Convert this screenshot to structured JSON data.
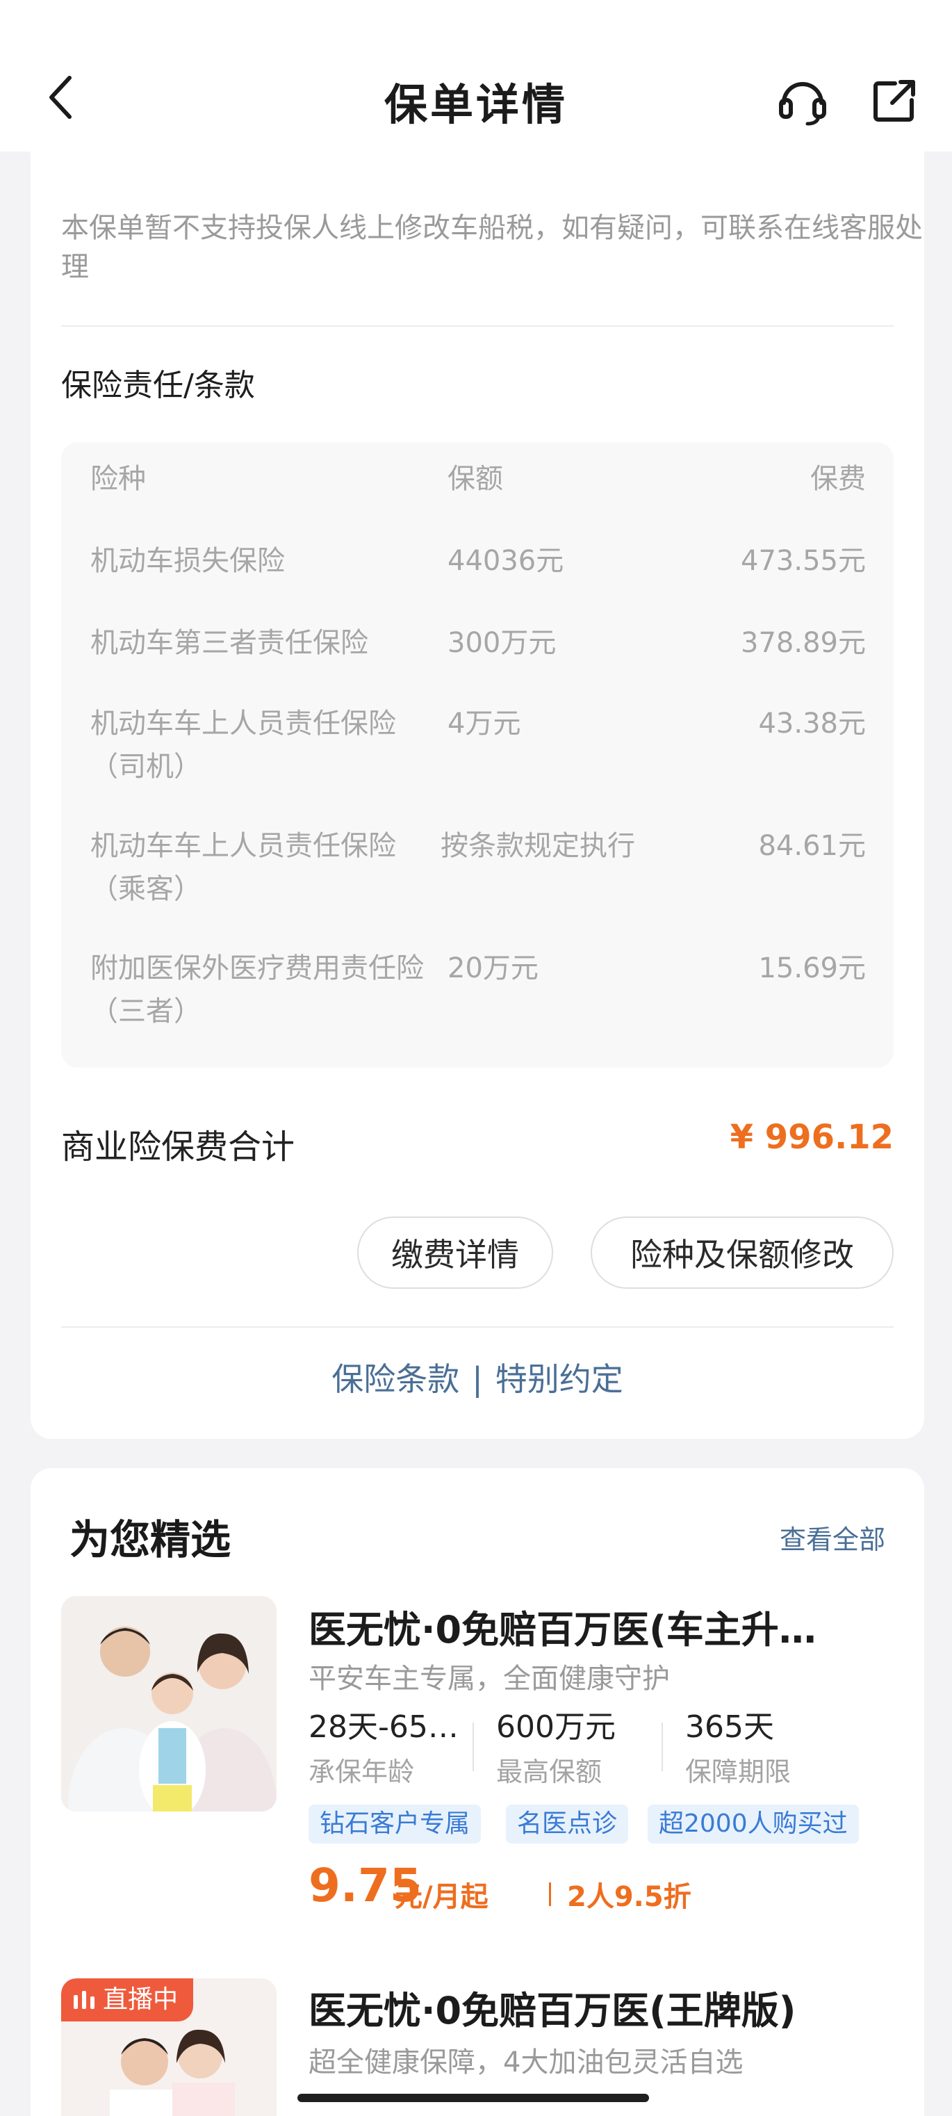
{
  "header": {
    "title": "保单详情"
  },
  "notice": "本保单暂不支持投保人线上修改车船税，如有疑问，可联系在线客服处理",
  "coverage": {
    "title": "保险责任/条款",
    "headers": [
      "险种",
      "保额",
      "保费"
    ],
    "rows": [
      {
        "name": "机动车损失保险",
        "amount": "44036元",
        "premium": "473.55元"
      },
      {
        "name": "机动车第三者责任保险",
        "amount": "300万元",
        "premium": "378.89元"
      },
      {
        "name": "机动车车上人员责任保险（司机）",
        "amount": "4万元",
        "premium": "43.38元"
      },
      {
        "name": "机动车车上人员责任保险（乘客）",
        "amount": "按条款规定执行",
        "premium": "84.61元"
      },
      {
        "name": "附加医保外医疗费用责任险（三者）",
        "amount": "20万元",
        "premium": "15.69元"
      }
    ]
  },
  "total": {
    "label": "商业险保费合计",
    "value": "¥ 996.12"
  },
  "buttons": {
    "payment_details": "缴费详情",
    "modify_coverage": "险种及保额修改"
  },
  "links": {
    "terms": "保险条款",
    "separator": "|",
    "special": "特别约定"
  },
  "recommend": {
    "title": "为您精选",
    "view_all": "查看全部",
    "products": [
      {
        "name": "医无忧·0免赔百万医(车主升…",
        "subtitle": "平安车主专属，全面健康守护",
        "stats": [
          {
            "value": "28天-65…",
            "label": "承保年龄"
          },
          {
            "value": "600万元",
            "label": "最高保额"
          },
          {
            "value": "365天",
            "label": "保障期限"
          }
        ],
        "tags": [
          "钻石客户专属",
          "名医点诊",
          "超2000人购买过"
        ],
        "price": "9.75",
        "price_unit": "元/月起",
        "discount": "2人9.5折"
      },
      {
        "badge": "直播中",
        "name": "医无忧·0免赔百万医(王牌版)",
        "subtitle": "超全健康保障，4大加油包灵活自选"
      }
    ]
  },
  "colors": {
    "accent_orange": "#ee6e1f",
    "link_blue": "#4a6f96",
    "tag_blue": "#3a7bd5",
    "live_red": "#ef5a3c"
  }
}
